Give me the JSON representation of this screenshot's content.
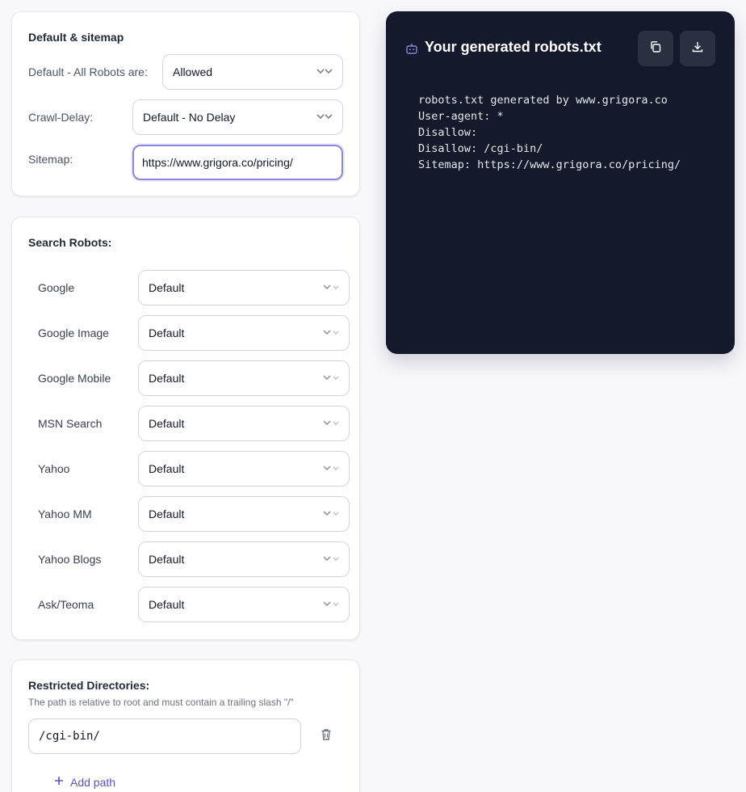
{
  "defaults_card": {
    "title": "Default & sitemap",
    "robots_label": "Default - All Robots are:",
    "robots_value": "Allowed",
    "crawl_label": "Crawl-Delay:",
    "crawl_value": "Default - No Delay",
    "sitemap_label": "Sitemap:",
    "sitemap_value": "https://www.grigora.co/pricing/"
  },
  "search_robots": {
    "title": "Search Robots:",
    "items": [
      {
        "name": "Google",
        "value": "Default"
      },
      {
        "name": "Google Image",
        "value": "Default"
      },
      {
        "name": "Google Mobile",
        "value": "Default"
      },
      {
        "name": "MSN Search",
        "value": "Default"
      },
      {
        "name": "Yahoo",
        "value": "Default"
      },
      {
        "name": "Yahoo MM",
        "value": "Default"
      },
      {
        "name": "Yahoo Blogs",
        "value": "Default"
      },
      {
        "name": "Ask/Teoma",
        "value": "Default"
      }
    ]
  },
  "restricted": {
    "title": "Restricted Directories:",
    "hint": "The path is relative to root and must contain a trailing slash \"/\"",
    "paths": [
      "/cgi-bin/"
    ],
    "add_label": "Add path"
  },
  "output": {
    "title": "Your generated robots.txt",
    "lines": [
      "robots.txt generated by www.grigora.co",
      "User-agent: *",
      "Disallow:",
      "Disallow: /cgi-bin/",
      "Sitemap: https://www.grigora.co/pricing/"
    ]
  },
  "colors": {
    "accent": "#5b50c9",
    "panel_bg": "#141a2b",
    "panel_button": "#2a3040",
    "focus_border": "#8b86dd"
  },
  "icons": {
    "robot": "robot-icon",
    "copy": "copy-icon",
    "download": "download-icon",
    "trash": "trash-icon",
    "plus": "plus-icon",
    "chevron": "chevron-down-icon"
  }
}
